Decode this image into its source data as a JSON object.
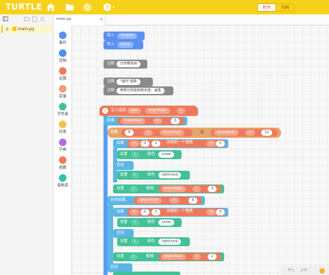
{
  "header": {
    "logo": "TURTLE",
    "mode_blocks": "积木",
    "mode_code": "代码"
  },
  "files": {
    "items": [
      {
        "name": "main.py"
      }
    ]
  },
  "tabs": [
    {
      "label": "main.py",
      "close": "×"
    }
  ],
  "categories": [
    {
      "label": "事件",
      "color": "#5b8ff0"
    },
    {
      "label": "控制",
      "color": "#4f8df0"
    },
    {
      "label": "运算",
      "color": "#f0795c"
    },
    {
      "label": "变量",
      "color": "#f39d77"
    },
    {
      "label": "字符串",
      "color": "#43c197"
    },
    {
      "label": "列表",
      "color": "#f4c14a"
    },
    {
      "label": "字典",
      "color": "#b26be0"
    },
    {
      "label": "函数",
      "color": "#f07c55"
    },
    {
      "label": "海龟库",
      "color": "#37bfa7"
    }
  ],
  "blocks": {
    "import_kw": "导入",
    "import1": "random",
    "import2": "turtle",
    "comment_kw": "注释",
    "comment1": "分形樱花树",
    "comment2": "\"递归\"函数",
    "comment3": "参数分别是树枝长度、画笔",
    "def_kw": "定义函数",
    "def_name": "tree",
    "def_param": "branchLen",
    "def_param2": "t",
    "if_kw": "如果",
    "var_branchLen": "branchLen",
    "op_gt": ">",
    "num_3": "3",
    "loop_kw": "如果",
    "num_8": "8",
    "op_lte": "≤",
    "and_kw": "且",
    "num_12": "12",
    "if2_kw": "如果",
    "num_0": "0",
    "num_2": "2",
    "rand_text": "间随机一个整数",
    "op_eq": "=",
    "set_kw": "设置",
    "var_t": "t",
    "color_kw": "颜色",
    "color_snow": "snow",
    "else_kw": "否则",
    "color_lightcoral": "lightcoral",
    "pensize_kw": "粗细",
    "op_div": "/",
    "elif_kw": "否则如果",
    "op_lt": "<"
  }
}
